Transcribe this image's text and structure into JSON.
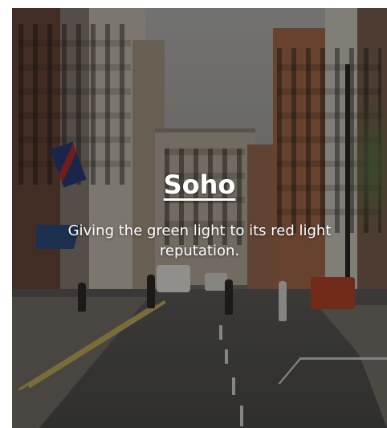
{
  "card": {
    "title": "Soho",
    "description": "Giving the green light to its red light reputation."
  }
}
